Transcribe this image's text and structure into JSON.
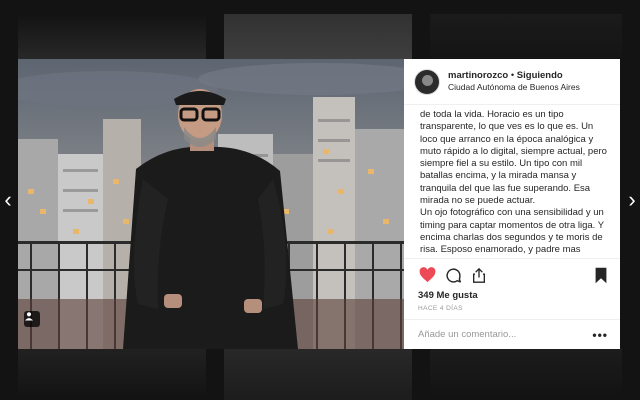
{
  "post": {
    "username": "martinorozco",
    "separator": "•",
    "follow_status": "Siguiendo",
    "location": "Ciudad Autónoma de Buenos Aires",
    "caption_lines": [
      "de toda la vida. Horacio es un tipo transparente, lo que ves es lo que es. Un loco que arranco en la época analógica y muto rápido a lo digital, siempre actual, pero siempre fiel a su estilo. Un tipo con mil batallas encima, y la mirada mansa y tranquila del que las fue superando. Esa mirada no se puede actuar.",
      "Un ojo fotográfico con una sensibilidad y un timing para captar momentos de otra liga. Y encima charlas dos segundos y te moris de risa. Esposo enamorado, y padre mas enamorado. Un gran tipo."
    ],
    "likes": "349 Me gusta",
    "time": "HACE 4 DÍAS",
    "comment_placeholder": "Añade un comentario...",
    "more_label": "•••",
    "liked": true,
    "like_color": "#ed4956"
  },
  "nav": {
    "prev": "‹",
    "next": "›"
  },
  "icons": {
    "like": "heart-icon",
    "comment": "comment-bubble-icon",
    "share": "share-icon",
    "save": "bookmark-icon",
    "tag": "user-tag-icon"
  }
}
